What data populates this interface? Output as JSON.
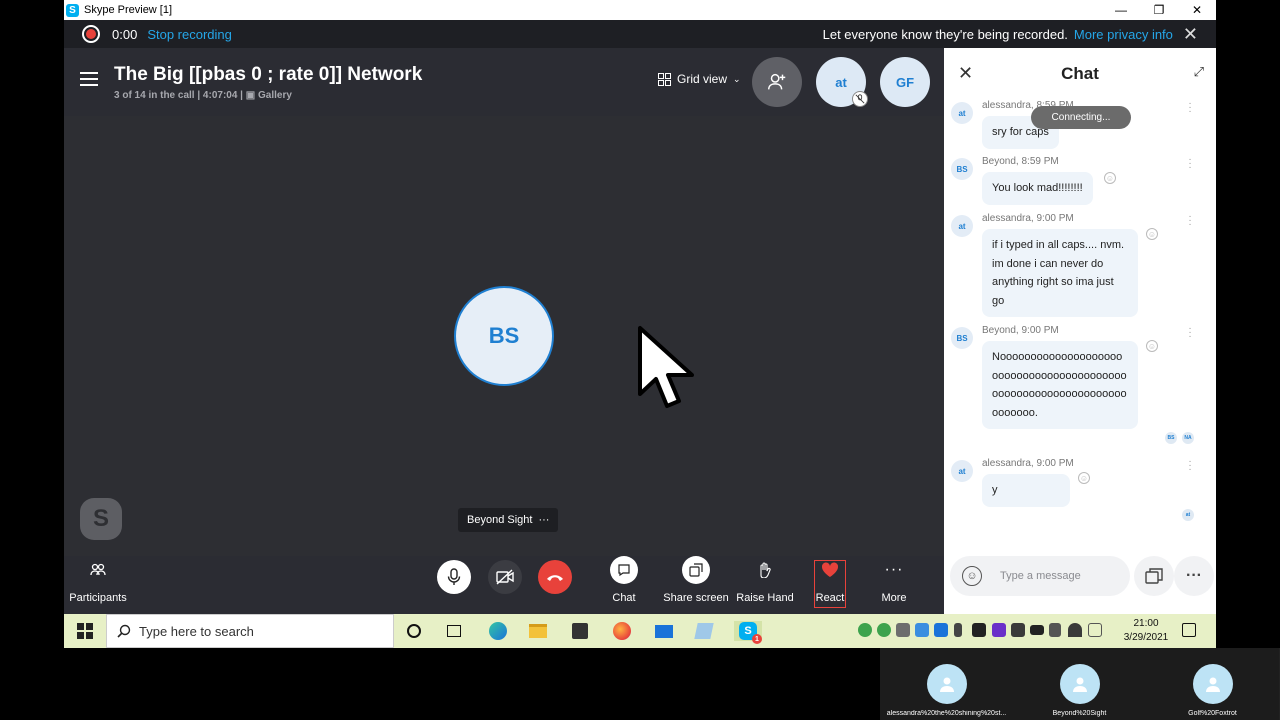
{
  "window": {
    "title": "Skype Preview [1]",
    "minimize": "—",
    "restore": "❐",
    "close": "✕"
  },
  "recording": {
    "timer": "0:00",
    "stop_label": "Stop recording",
    "message": "Let everyone know they're being recorded.",
    "privacy_link": "More privacy info",
    "close": "✕"
  },
  "call": {
    "title": "The Big [[pbas 0 ; rate 0]] Network",
    "subtitle": "3 of 14 in the call | 4:07:04 |",
    "gallery_label": "Gallery",
    "view_label": "Grid view",
    "header_avatars": [
      {
        "initials": "at",
        "muted": true
      },
      {
        "initials": "GF",
        "muted": false
      }
    ],
    "main_avatar": "BS",
    "watermark": "S",
    "name_tag": "Beyond Sight",
    "name_tag_more": "···"
  },
  "controls": {
    "participants": "Participants",
    "chat": "Chat",
    "share_screen": "Share screen",
    "raise_hand": "Raise Hand",
    "react": "React",
    "more": "More",
    "accent_colors": {
      "end_call": "#e8423b",
      "react_border": "#e8423b"
    }
  },
  "chat": {
    "title": "Chat",
    "close": "✕",
    "expand": "⤢",
    "connecting": "Connecting...",
    "messages": [
      {
        "avatar": "at",
        "meta": "alessandra, 8:59 PM",
        "text": "sry for caps"
      },
      {
        "avatar": "BS",
        "meta": "Beyond, 8:59 PM",
        "text": "You look mad!!!!!!!!"
      },
      {
        "avatar": "at",
        "meta": "alessandra, 9:00 PM",
        "text": "if i typed in all caps.... nvm. im done i can never do anything right so ima just go"
      },
      {
        "avatar": "BS",
        "meta": "Beyond, 9:00 PM",
        "text": "Nooooooooooooooooooooooooooooooooooooooooooooooooooooooooooooooooooooooo."
      },
      {
        "avatar": "at",
        "meta": "alessandra, 9:00 PM",
        "text": "y"
      }
    ],
    "read_receipts_1": [
      "BS",
      "NA"
    ],
    "read_receipts_2": [
      "at"
    ],
    "composer_placeholder": "Type a message"
  },
  "taskbar": {
    "search_placeholder": "Type here to search",
    "time": "21:00",
    "date": "3/29/2021",
    "skype_badge": "1"
  },
  "thumbnails": [
    {
      "name": "alessandra%20the%20shining%20st..."
    },
    {
      "name": "Beyond%20Sight"
    },
    {
      "name": "Golf%20Foxtrot"
    }
  ]
}
